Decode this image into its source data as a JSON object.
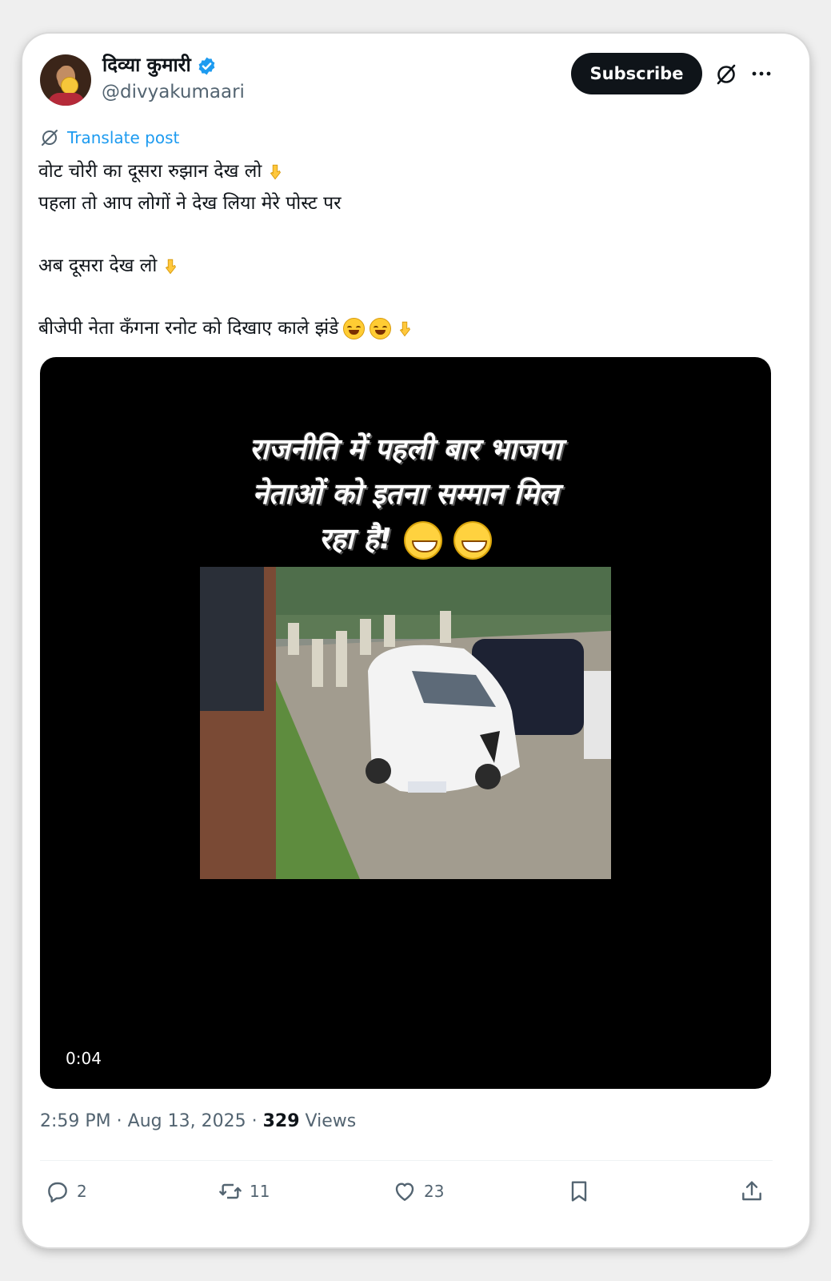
{
  "author": {
    "display_name": "दिव्या कुमारी",
    "handle": "@divyakumaari",
    "verified": true
  },
  "header": {
    "subscribe_label": "Subscribe"
  },
  "translate_label": "Translate post",
  "post_text": {
    "line1": "वोट चोरी का दूसरा रुझान देख लो",
    "line2": "पहला तो आप लोगों ने देख लिया मेरे पोस्ट पर",
    "line3": "अब दूसरा देख लो",
    "line4": "बीजेपी नेता कँगना रनोट को दिखाए काले झंडे"
  },
  "video": {
    "caption_line1": "राजनीति में पहली बार भाजपा",
    "caption_line2": "नेताओं को इतना सम्मान मिल",
    "caption_line3": "रहा है!",
    "timestamp": "0:04"
  },
  "meta": {
    "time": "2:59 PM",
    "date": "Aug 13, 2025",
    "views_count": "329",
    "views_label": "Views"
  },
  "actions": {
    "replies": "2",
    "reposts": "11",
    "likes": "23"
  },
  "colors": {
    "accent": "#1d9bf0",
    "text": "#0f1419",
    "muted": "#536471",
    "button_bg": "#0f1419"
  }
}
